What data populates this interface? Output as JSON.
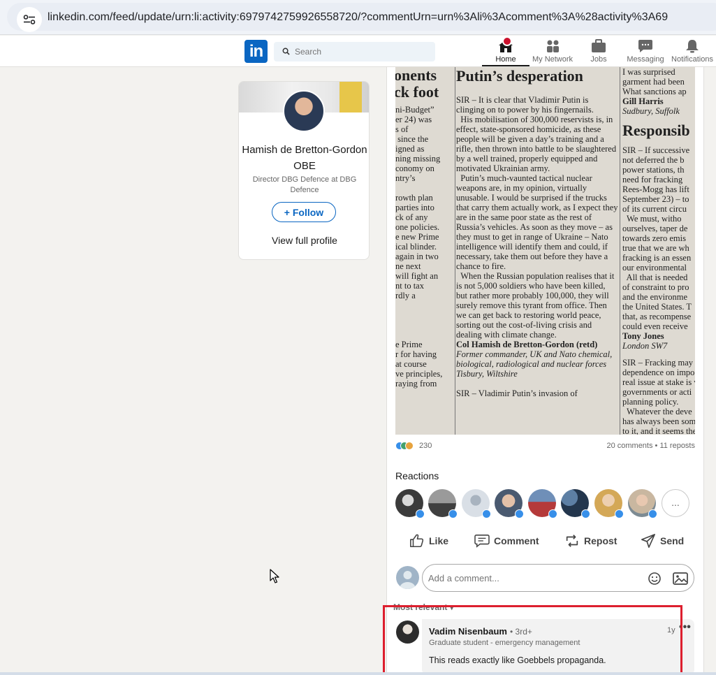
{
  "browser": {
    "url": "linkedin.com/feed/update/urn:li:activity:6979742759926558720/?commentUrn=urn%3Ali%3Acomment%3A%28activity%3A69"
  },
  "nav": {
    "search_placeholder": "Search",
    "items": [
      {
        "label": "Home",
        "icon": "home-icon",
        "active": true
      },
      {
        "label": "My Network",
        "icon": "network-icon"
      },
      {
        "label": "Jobs",
        "icon": "briefcase-icon"
      },
      {
        "label": "Messaging",
        "icon": "messaging-icon"
      },
      {
        "label": "Notifications",
        "icon": "bell-icon"
      }
    ],
    "logo_text": "in"
  },
  "profile": {
    "name": "Hamish de Bretton-Gordon OBE",
    "headline": "Director DBG Defence at DBG Defence",
    "follow_label": "+ Follow",
    "view_profile_label": "View full profile"
  },
  "post": {
    "newspaper": {
      "left_headline": "onents\nck foot",
      "left_body": "ni-Budget”\ner 24) was\ns of\n since the\nigned as\nning missing\nconomy on\nntry’s\n\nrowth plan\nparties into\nck of any\none policies.\ne new Prime\nical blinder.\nagain in two\nne next\nwill fight an\nnt to tax\nrdly a\n\n\n\n\ne Prime\nr for having\nat course\nve principles,\nraying from",
      "mid_headline": "Putin’s desperation",
      "mid_body": "SIR – It is clear that Vladimir Putin is clinging on to power by his fingernails.\n  His mobilisation of 300,000 reservists is, in effect, state-sponsored homicide, as these people will be given a day’s training and a rifle, then thrown into battle to be slaughtered by a well trained, properly equipped and motivated Ukrainian army.\n  Putin’s much-vaunted tactical nuclear weapons are, in my opinion, virtually unusable. I would be surprised if the trucks that carry them actually work, as I expect they are in the same poor state as the rest of Russia’s vehicles. As soon as they move – as they must to get in range of Ukraine – Nato intelligence will identify them and could, if necessary, take them out before they have a chance to fire.\n  When the Russian population realises that it is not 5,000 soldiers who have been killed, but rather more probably 100,000, they will surely remove this tyrant from office. Then we can get back to restoring world peace, sorting out the cost-of-living crisis and dealing with climate change.",
      "mid_signature": "Col Hamish de Bretton-Gordon (retd)",
      "mid_sig_detail": "Former commander, UK and Nato chemical, biological, radiological and nuclear forces",
      "mid_sig_place": "Tisbury, Wiltshire",
      "mid_footer": "SIR – Vladimir Putin’s invasion of",
      "right_top": "I was surprised\ngarment had been\nWhat sanctions ap",
      "right_sig1": "Gill Harris",
      "right_place1": "Sudbury, Suffolk",
      "right_headline": "Responsib",
      "right_body": "SIR – If successive\nnot deferred the b\npower stations, th\nneed for fracking\nRees-Mogg has lift\nSeptember 23) – to\nof its current circu\n  We must, witho\nourselves, taper de\ntowards zero emis\ntrue that we are wh\nfracking is an essen\nour environmental\n  All that is needed\nof constraint to pro\nand the environme\nthe United States. T\nthat, as recompense\ncould even receive",
      "right_sig2": "Tony Jones",
      "right_place2": "London SW7",
      "right_body2": "SIR – Fracking may b\ndependence on impo\nreal issue at stake is v\ngovernments or acti\nplanning policy.\n  Whatever the deve\nhas always been som\nto it, and it seems the"
    },
    "reaction_count": "230",
    "comments_reposts": "20 comments • 11 reposts",
    "reactions_title": "Reactions",
    "reactors_more": "...",
    "actions": [
      {
        "label": "Like",
        "icon": "like-icon"
      },
      {
        "label": "Comment",
        "icon": "comment-icon"
      },
      {
        "label": "Repost",
        "icon": "repost-icon"
      },
      {
        "label": "Send",
        "icon": "send-icon"
      }
    ],
    "comment_placeholder": "Add a comment...",
    "sort_label": "Most relevant ▾"
  },
  "comment": {
    "author": "Vadim Nisenbaum",
    "degree": "• 3rd+",
    "headline": "Graduate student - emergency management",
    "time": "1y",
    "more": "•••",
    "text": "This reads exactly like Goebbels propaganda."
  },
  "colors": {
    "brand": "#0a66c2",
    "highlight": "#dd1f2e",
    "notification_badge": "#cb112d"
  }
}
